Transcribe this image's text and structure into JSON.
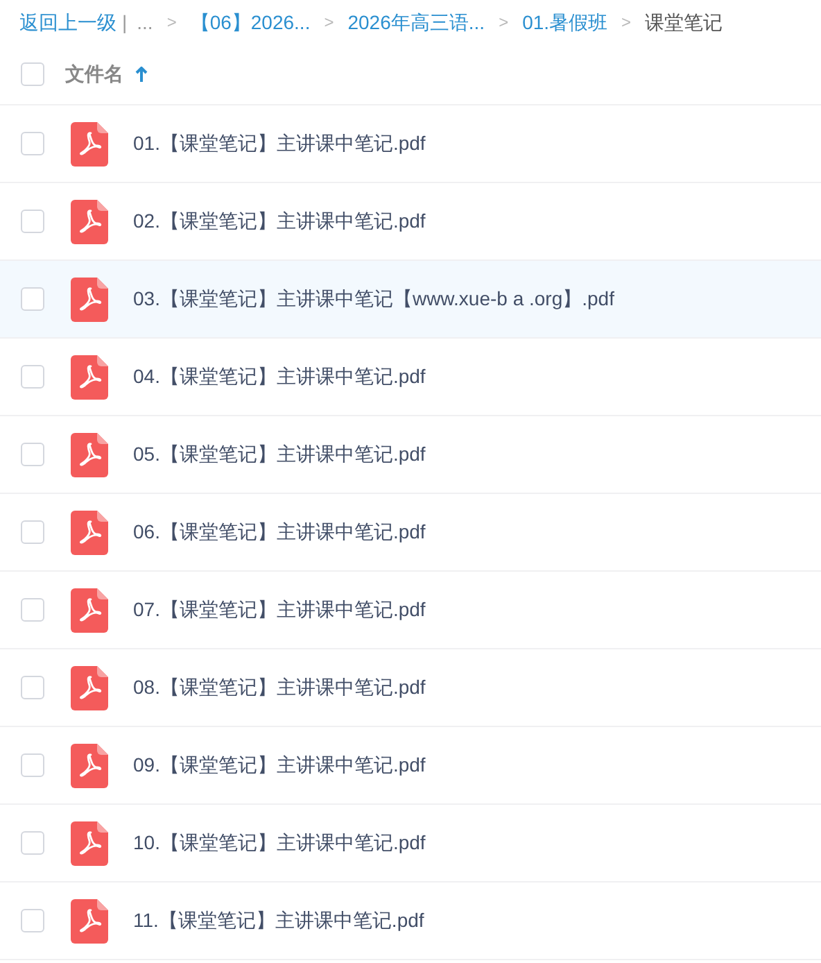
{
  "breadcrumb": {
    "back": "返回上一级",
    "divider": "|",
    "separator": ">",
    "crumbs": [
      {
        "label": "...",
        "current": false,
        "kind": "ellipsis"
      },
      {
        "label": "【06】2026...",
        "current": false,
        "kind": "link"
      },
      {
        "label": "2026年高三语...",
        "current": false,
        "kind": "link"
      },
      {
        "label": "01.暑假班",
        "current": false,
        "kind": "link"
      },
      {
        "label": "课堂笔记",
        "current": true,
        "kind": "link"
      }
    ]
  },
  "header": {
    "checked": false,
    "column": "文件名",
    "sorted_ascending": true
  },
  "files": [
    {
      "name": "01.【课堂笔记】主讲课中笔记.pdf",
      "checked": false,
      "highlighted": false
    },
    {
      "name": "02.【课堂笔记】主讲课中笔记.pdf",
      "checked": false,
      "highlighted": false
    },
    {
      "name": "03.【课堂笔记】主讲课中笔记【www.xue-b a .org】.pdf",
      "checked": false,
      "highlighted": true
    },
    {
      "name": "04.【课堂笔记】主讲课中笔记.pdf",
      "checked": false,
      "highlighted": false
    },
    {
      "name": "05.【课堂笔记】主讲课中笔记.pdf",
      "checked": false,
      "highlighted": false
    },
    {
      "name": "06.【课堂笔记】主讲课中笔记.pdf",
      "checked": false,
      "highlighted": false
    },
    {
      "name": "07.【课堂笔记】主讲课中笔记.pdf",
      "checked": false,
      "highlighted": false
    },
    {
      "name": "08.【课堂笔记】主讲课中笔记.pdf",
      "checked": false,
      "highlighted": false
    },
    {
      "name": "09.【课堂笔记】主讲课中笔记.pdf",
      "checked": false,
      "highlighted": false
    },
    {
      "name": "10.【课堂笔记】主讲课中笔记.pdf",
      "checked": false,
      "highlighted": false
    },
    {
      "name": "11.【课堂笔记】主讲课中笔记.pdf",
      "checked": false,
      "highlighted": false
    }
  ]
}
